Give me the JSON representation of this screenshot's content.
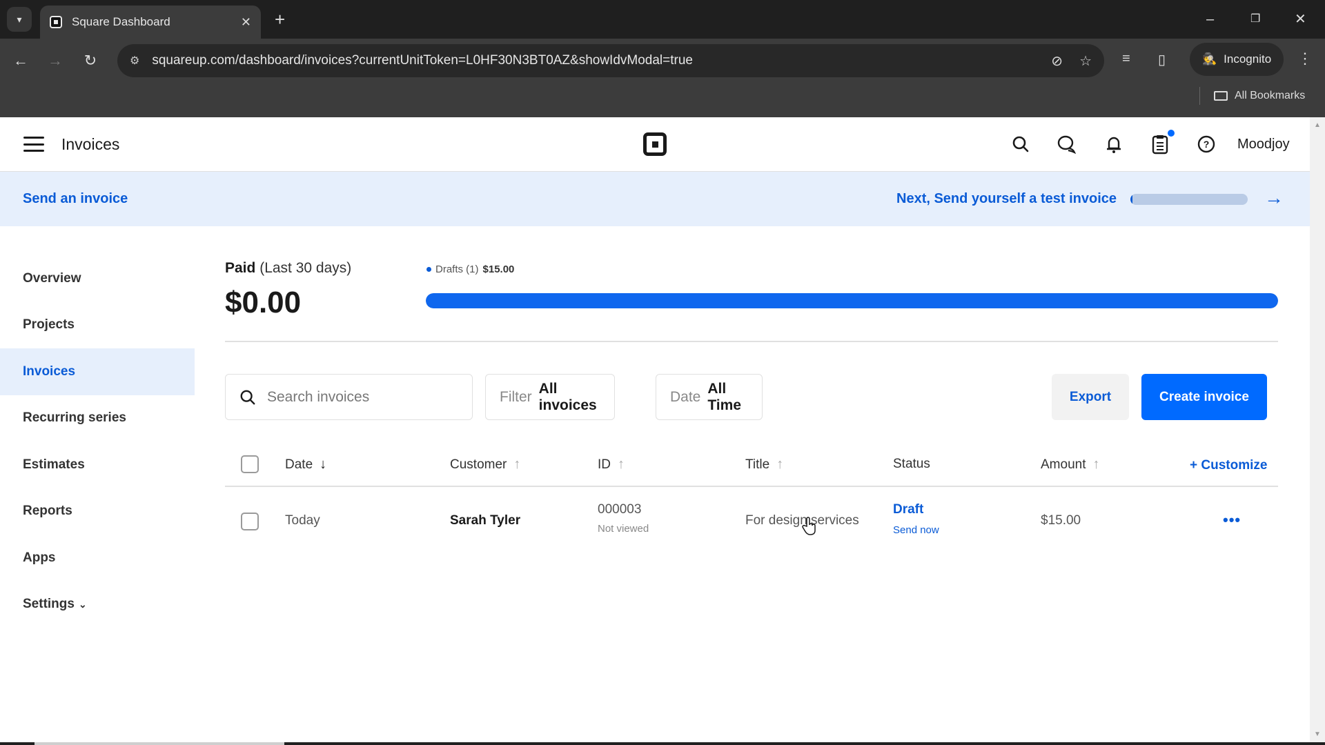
{
  "browser": {
    "tab_title": "Square Dashboard",
    "url": "squareup.com/dashboard/invoices?currentUnitToken=L0HF30N3BT0AZ&showIdvModal=true",
    "incognito_label": "Incognito",
    "bookmarks_label": "All Bookmarks",
    "icons": {
      "tab_list": "▾",
      "close": "✕",
      "new_tab": "+",
      "minimize": "–",
      "restore": "❐",
      "window_close": "✕",
      "back": "←",
      "forward": "→",
      "reload": "↻",
      "site_settings": "⚙",
      "eye_off": "⊘",
      "star": "☆",
      "media": "≡",
      "side_panel": "▯",
      "incognito": "🕵",
      "menu": "⋮"
    }
  },
  "header": {
    "title": "Invoices",
    "account_name": "Moodjoy",
    "icons": {
      "search": "search-icon",
      "messages": "messages-icon",
      "notifications": "bell-icon",
      "checklist": "clipboard-icon",
      "help": "help-icon"
    }
  },
  "banner": {
    "left_link": "Send an invoice",
    "next_step": "Next, Send yourself a test invoice",
    "progress_fraction": 0.02,
    "arrow": "→"
  },
  "sidebar": {
    "items": [
      {
        "label": "Overview",
        "active": false
      },
      {
        "label": "Projects",
        "active": false
      },
      {
        "label": "Invoices",
        "active": true
      },
      {
        "label": "Recurring series",
        "active": false
      },
      {
        "label": "Estimates",
        "active": false
      },
      {
        "label": "Reports",
        "active": false
      },
      {
        "label": "Apps",
        "active": false
      },
      {
        "label": "Settings",
        "active": false,
        "chevron": "⌄"
      }
    ]
  },
  "summary": {
    "paid_label": "Paid",
    "paid_period": "(Last 30 days)",
    "paid_amount": "$0.00",
    "legend_label": "Drafts (1)",
    "legend_amount": "$15.00",
    "drafts_fraction": 1.0,
    "accent_color": "#0f67ee"
  },
  "toolbar": {
    "search_placeholder": "Search invoices",
    "filter_key": "Filter",
    "filter_value": "All invoices",
    "date_key": "Date",
    "date_value": "All Time",
    "export_label": "Export",
    "create_label": "Create invoice",
    "create_color": "#006aff"
  },
  "table": {
    "columns": [
      {
        "label": "Date",
        "sort": "↓"
      },
      {
        "label": "Customer",
        "sort": "↑"
      },
      {
        "label": "ID",
        "sort": "↑"
      },
      {
        "label": "Title",
        "sort": "↑"
      },
      {
        "label": "Status",
        "sort": ""
      },
      {
        "label": "Amount",
        "sort": "↑"
      }
    ],
    "customize_label": "+ Customize",
    "rows": [
      {
        "date": "Today",
        "customer": "Sarah Tyler",
        "id": "000003",
        "id_sub": "Not viewed",
        "title": "For design services",
        "status": "Draft",
        "status_action": "Send now",
        "amount": "$15.00",
        "more": "•••"
      }
    ]
  }
}
